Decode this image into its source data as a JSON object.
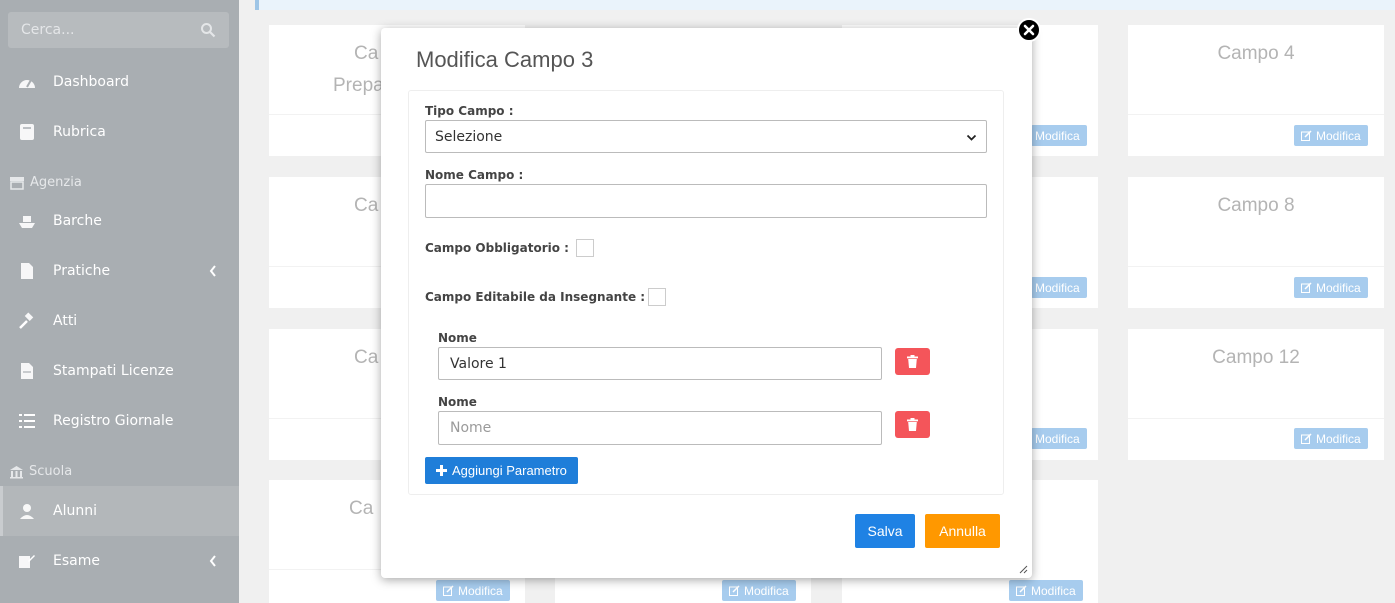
{
  "sidebar": {
    "search_placeholder": "Cerca...",
    "items": [
      {
        "label": "Dashboard",
        "icon": "dashboard-icon"
      },
      {
        "label": "Rubrica",
        "icon": "book-icon"
      },
      {
        "label": "Barche",
        "icon": "ship-icon"
      },
      {
        "label": "Pratiche",
        "icon": "file-icon"
      },
      {
        "label": "Atti",
        "icon": "gavel-icon"
      },
      {
        "label": "Stampati Licenze",
        "icon": "document-icon"
      },
      {
        "label": "Registro Giornale",
        "icon": "list-icon"
      },
      {
        "label": "Alunni",
        "icon": "student-icon"
      },
      {
        "label": "Esame",
        "icon": "edit-icon"
      }
    ],
    "headers": {
      "agenzia": "Agenzia",
      "scuola": "Scuola"
    }
  },
  "cards": {
    "partial_titles": [
      "Ca",
      "Prepa",
      "Ca",
      "Ca",
      "Ca"
    ],
    "titles_right": [
      "Campo 4",
      "Campo 8",
      "Campo 12"
    ],
    "modify_label": "Modifica"
  },
  "modal": {
    "title": "Modifica Campo 3",
    "tipo_label": "Tipo Campo :",
    "tipo_value": "Selezione",
    "nome_label": "Nome Campo :",
    "nome_value": "",
    "obbligatorio_label": "Campo Obbligatorio :",
    "editabile_label": "Campo Editabile da Insegnante :",
    "params": [
      {
        "label": "Nome",
        "value": "Valore 1",
        "placeholder": "Nome"
      },
      {
        "label": "Nome",
        "value": "",
        "placeholder": "Nome"
      }
    ],
    "add_label": "Aggiungi Parametro",
    "save_label": "Salva",
    "cancel_label": "Annulla"
  },
  "colors": {
    "sidebar": "#a9aeb2",
    "primary": "#1f7ed9",
    "save": "#1f82e4",
    "cancel": "#ff9800",
    "danger": "#f4555a"
  }
}
